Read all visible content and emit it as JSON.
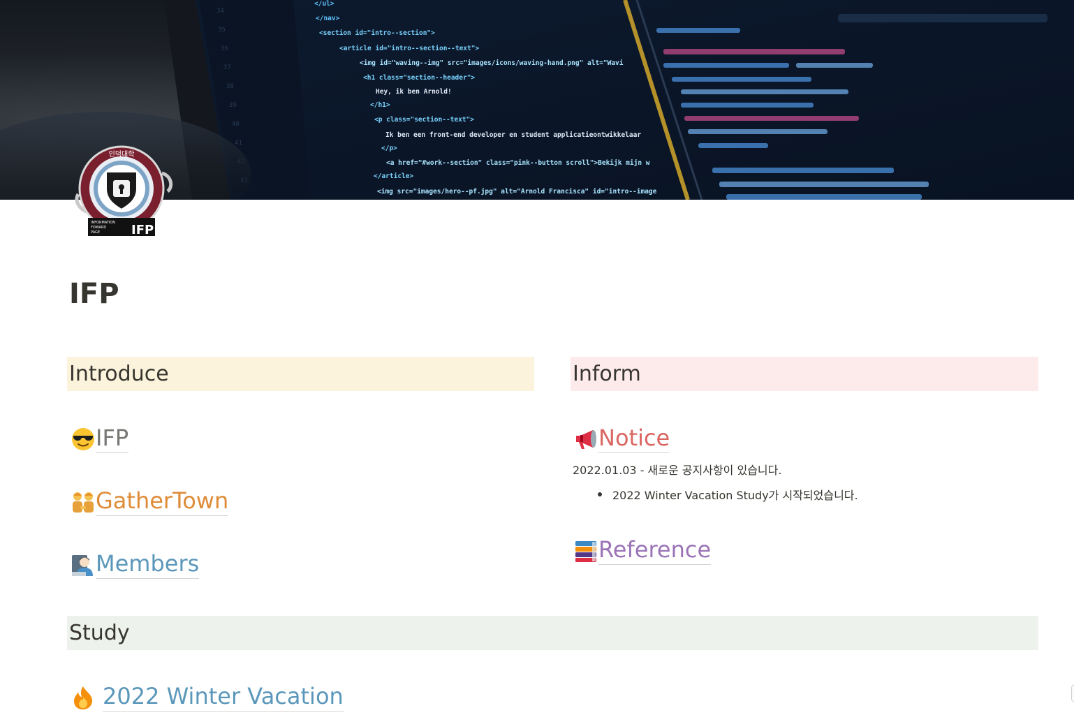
{
  "cover": {
    "alt": "code on laptop screen",
    "code_lines": [
      "</ul>",
      "</nav>",
      "<section id=\"intro--section\">",
      "<article id=\"intro--section--text\">",
      "<img id=\"waving--img\" src=\"images/icons/waving-hand.png\" alt=\"Wavi",
      "<h1 class=\"section--header\">",
      "Hey, ik ben Arnold!",
      "</h1>",
      "<p class=\"section--text\">",
      "Ik ben een front-end developer en student applicatieontwikkelaar",
      "</p>",
      "<a href=\"#work--section\" class=\"pink--button scroll\">Bekijk mijn w",
      "</article>",
      "<img src=\"images/hero--pf.jpg\" alt=\"Arnold Francisca\" id=\"intro--image"
    ]
  },
  "logo": {
    "ring_text": "인덕대학",
    "caption_small": [
      "INFORMATION",
      "FOWARD",
      "PAGE"
    ],
    "caption_big": "IFP"
  },
  "page": {
    "title": "IFP"
  },
  "sections": {
    "introduce": {
      "heading": "Introduce",
      "items": [
        {
          "icon": "sunglasses-face-icon",
          "label": "IFP"
        },
        {
          "icon": "people-holding-hands-icon",
          "label": "GatherTown"
        },
        {
          "icon": "technologist-icon",
          "label": "Members"
        }
      ]
    },
    "inform": {
      "heading": "Inform",
      "notice": {
        "icon": "megaphone-icon",
        "label": "Notice",
        "text": "2022.01.03 - 새로운 공지사항이 있습니다.",
        "bullet": "2022 Winter Vacation Study가 시작되었습니다."
      },
      "reference": {
        "icon": "books-icon",
        "label": "Reference"
      }
    },
    "study": {
      "heading": "Study",
      "items": [
        {
          "icon": "fire-icon",
          "label": "2022 Winter Vacation"
        }
      ]
    }
  },
  "colors": {
    "introduce_bg": "#fbf3db",
    "inform_bg": "#fdebec",
    "study_bg": "#edf3ec",
    "gray_link": "#787774",
    "orange_link": "#d9730d",
    "blue_link": "#337ea9",
    "red_link": "#d44c47",
    "purple_link": "#9065b0"
  }
}
